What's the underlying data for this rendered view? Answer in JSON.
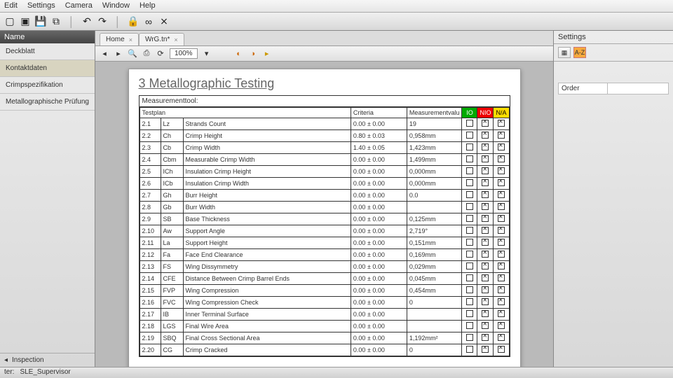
{
  "menu": {
    "items": [
      "Edit",
      "Settings",
      "Camera",
      "Window",
      "Help"
    ]
  },
  "toolbar_icons": [
    "new",
    "open",
    "save",
    "save-all",
    "|",
    "undo",
    "redo",
    "|",
    "lock",
    "link",
    "unlink"
  ],
  "sidebar": {
    "header": "Name",
    "items": [
      {
        "label": "Deckblatt"
      },
      {
        "label": "Kontaktdaten",
        "selected": true
      },
      {
        "label": "Crimpspezifikation"
      },
      {
        "label": "Metallographische Prüfung"
      }
    ],
    "footer_label": "Inspection"
  },
  "tabs": [
    {
      "label": "Home",
      "closable": true
    },
    {
      "label": "WrG.tn*",
      "closable": true
    }
  ],
  "doc_toolbar": {
    "zoom": "100%",
    "icons": [
      "prev",
      "next",
      "sep",
      "search",
      "sep",
      "zoom-out",
      "zoom-in",
      "sep",
      "refresh",
      "play"
    ]
  },
  "document": {
    "title": "3 Metallographic Testing",
    "measurementtool": "Measurementtool:",
    "headers": {
      "testplan": "Testplan",
      "criteria": "Criteria",
      "measval": "Measurementvalu",
      "io": "IO",
      "nio": "NIO",
      "na": "N/A"
    },
    "rows": [
      {
        "num": "2.1",
        "code": "Lz",
        "name": "Strands Count",
        "crit": "0.00 ± 0.00",
        "val": "19"
      },
      {
        "num": "2.2",
        "code": "Ch",
        "name": "Crimp Height",
        "crit": "0.80 ± 0.03",
        "val": "0,958mm"
      },
      {
        "num": "2.3",
        "code": "Cb",
        "name": "Crimp Width",
        "crit": "1.40 ± 0.05",
        "val": "1,423mm"
      },
      {
        "num": "2.4",
        "code": "Cbm",
        "name": "Measurable Crimp Width",
        "crit": "0.00 ± 0.00",
        "val": "1,499mm"
      },
      {
        "num": "2.5",
        "code": "ICh",
        "name": "Insulation Crimp Height",
        "crit": "0.00 ± 0.00",
        "val": "0,000mm"
      },
      {
        "num": "2.6",
        "code": "ICb",
        "name": "Insulation Crimp Width",
        "crit": "0.00 ± 0.00",
        "val": "0,000mm"
      },
      {
        "num": "2.7",
        "code": "Gh",
        "name": "Burr Height",
        "crit": "0.00 ± 0.00",
        "val": "0.0"
      },
      {
        "num": "2.8",
        "code": "Gb",
        "name": "Burr Width",
        "crit": "0.00 ± 0.00",
        "val": ""
      },
      {
        "num": "2.9",
        "code": "SB",
        "name": "Base Thickness",
        "crit": "0.00 ± 0.00",
        "val": "0,125mm"
      },
      {
        "num": "2.10",
        "code": "Aw",
        "name": "Support Angle",
        "crit": "0.00 ± 0.00",
        "val": "2,719°"
      },
      {
        "num": "2.11",
        "code": "La",
        "name": "Support Height",
        "crit": "0.00 ± 0.00",
        "val": "0,151mm"
      },
      {
        "num": "2.12",
        "code": "Fa",
        "name": "Face End Clearance",
        "crit": "0.00 ± 0.00",
        "val": "0,169mm"
      },
      {
        "num": "2.13",
        "code": "FS",
        "name": "Wing Dissymmetry",
        "crit": "0.00 ± 0.00",
        "val": "0,029mm"
      },
      {
        "num": "2.14",
        "code": "CFE",
        "name": "Distance Between Crimp Barrel Ends",
        "crit": "0.00 ± 0.00",
        "val": "0,045mm"
      },
      {
        "num": "2.15",
        "code": "FVP",
        "name": "Wing Compression",
        "crit": "0.00 ± 0.00",
        "val": "0,454mm"
      },
      {
        "num": "2.16",
        "code": "FVC",
        "name": "Wing Compression Check",
        "crit": "0.00 ± 0.00",
        "val": "0"
      },
      {
        "num": "2.17",
        "code": "IB",
        "name": "Inner Terminal Surface",
        "crit": "0.00 ± 0.00",
        "val": ""
      },
      {
        "num": "2.18",
        "code": "LGS",
        "name": "Final Wire Area",
        "crit": "0.00 ± 0.00",
        "val": ""
      },
      {
        "num": "2.19",
        "code": "SBQ",
        "name": "Final Cross Sectional Area",
        "crit": "0.00 ± 0.00",
        "val": "1,192mm²"
      },
      {
        "num": "2.20",
        "code": "CG",
        "name": "Crimp Cracked",
        "crit": "0.00 ± 0.00",
        "val": "0"
      }
    ]
  },
  "right": {
    "header": "Settings",
    "sort_label": "A-Z",
    "order_label": "Order",
    "order_value": ""
  },
  "status": {
    "user_label": "ter:",
    "user": "SLE_Supervisor"
  }
}
